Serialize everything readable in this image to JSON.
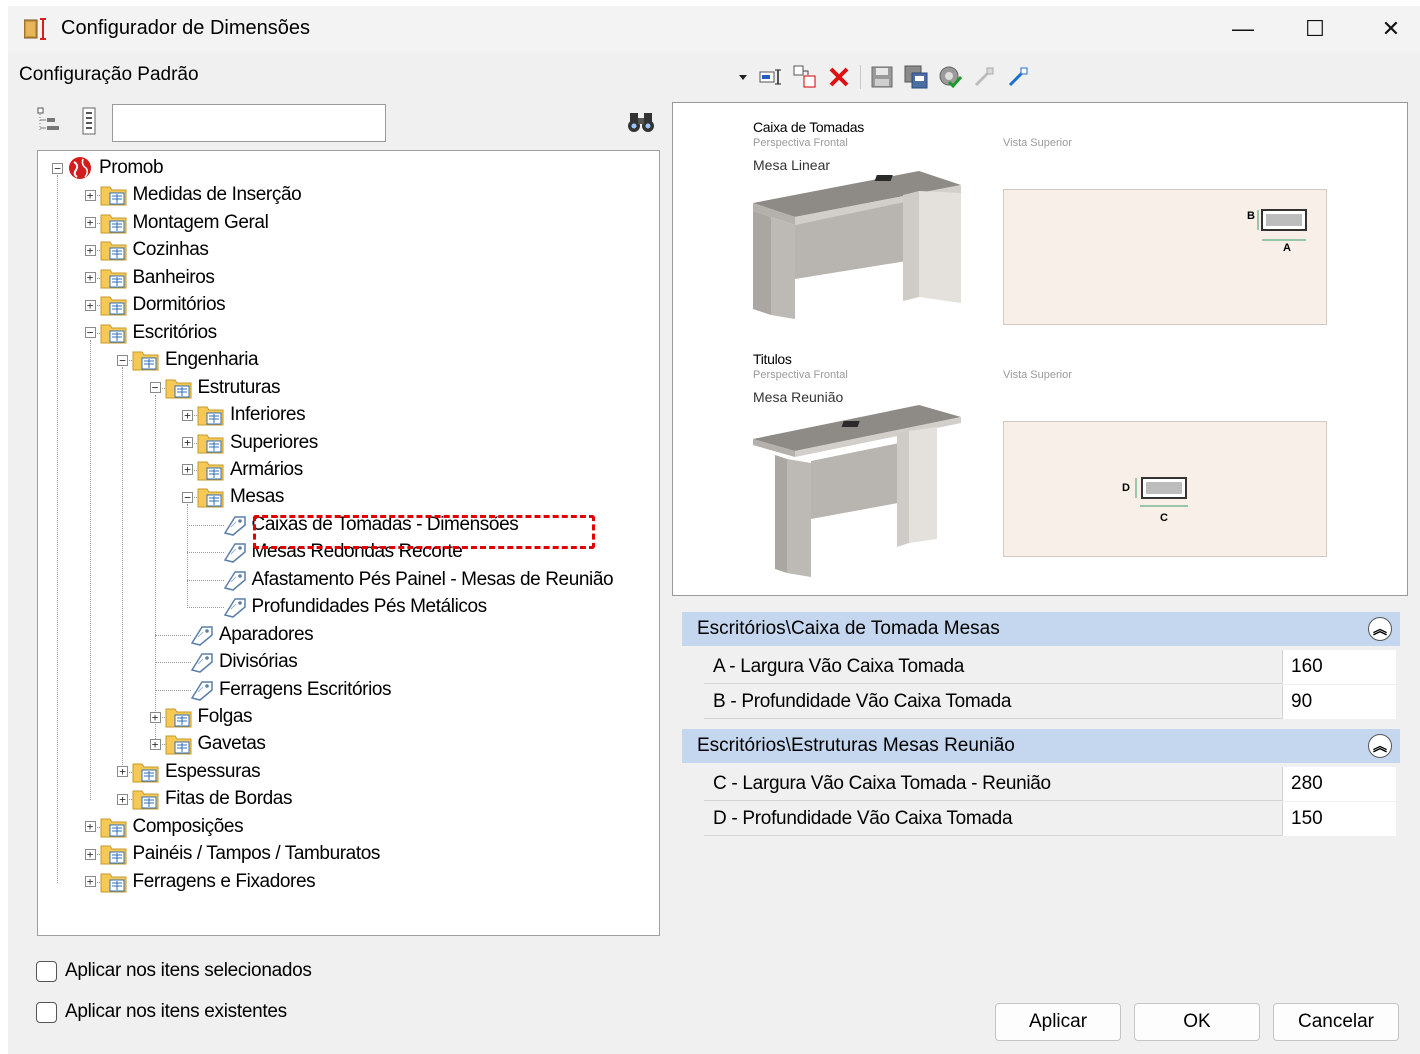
{
  "window": {
    "title": "Configurador de Dimensões"
  },
  "header": {
    "config_label": "Configuração Padrão"
  },
  "toolbar": {
    "icons": [
      "dropdown-icon",
      "rename-icon",
      "new-config-icon",
      "delete-icon",
      "save-icon",
      "save-as-icon",
      "validate-icon",
      "import-icon",
      "export-icon"
    ]
  },
  "search": {
    "value": ""
  },
  "tree": {
    "nodes": [
      {
        "label": "Promob"
      },
      {
        "label": "Medidas de Inserção"
      },
      {
        "label": "Montagem Geral"
      },
      {
        "label": "Cozinhas"
      },
      {
        "label": "Banheiros"
      },
      {
        "label": "Dormitórios"
      },
      {
        "label": "Escritórios"
      },
      {
        "label": "Engenharia"
      },
      {
        "label": "Estruturas"
      },
      {
        "label": "Inferiores"
      },
      {
        "label": "Superiores"
      },
      {
        "label": "Armários"
      },
      {
        "label": "Mesas"
      },
      {
        "label": "Caixas de Tomadas - Dimensões"
      },
      {
        "label": "Mesas Redondas Recorte"
      },
      {
        "label": "Afastamento Pés Painel - Mesas de Reunião"
      },
      {
        "label": "Profundidades Pés Metálicos"
      },
      {
        "label": "Aparadores"
      },
      {
        "label": "Divisórias"
      },
      {
        "label": "Ferragens Escritórios"
      },
      {
        "label": "Folgas"
      },
      {
        "label": "Gavetas"
      },
      {
        "label": "Espessuras"
      },
      {
        "label": "Fitas de Bordas"
      },
      {
        "label": "Composições"
      },
      {
        "label": "Painéis / Tampos / Tamburatos"
      },
      {
        "label": "Ferragens e Fixadores"
      }
    ]
  },
  "preview": {
    "block1": {
      "title": "Caixa de Tomadas",
      "persp": "Perspectiva Frontal",
      "view": "Vista Superior",
      "name": "Mesa Linear",
      "dim_a": "A",
      "dim_b": "B"
    },
    "block2": {
      "title": "Titulos",
      "persp": "Perspectiva Frontal",
      "view": "Vista Superior",
      "name": "Mesa Reunião",
      "dim_c": "C",
      "dim_d": "D"
    }
  },
  "groups": [
    {
      "title": "Escritórios\\Caixa de Tomada Mesas",
      "rows": [
        {
          "label": "A - Largura Vão Caixa Tomada",
          "value": "160"
        },
        {
          "label": "B - Profundidade Vão Caixa Tomada",
          "value": "90"
        }
      ]
    },
    {
      "title": "Escritórios\\Estruturas Mesas Reunião",
      "rows": [
        {
          "label": "C - Largura Vão Caixa Tomada - Reunião",
          "value": "280"
        },
        {
          "label": "D - Profundidade Vão Caixa Tomada",
          "value": "150"
        }
      ]
    }
  ],
  "options": {
    "apply_selected": "Aplicar nos itens selecionados",
    "apply_existing": "Aplicar nos itens existentes"
  },
  "buttons": {
    "apply": "Aplicar",
    "ok": "OK",
    "cancel": "Cancelar"
  },
  "colors": {
    "group_header": "#c5d7ee",
    "highlight": "#e00000",
    "folder": "#f6c955"
  }
}
